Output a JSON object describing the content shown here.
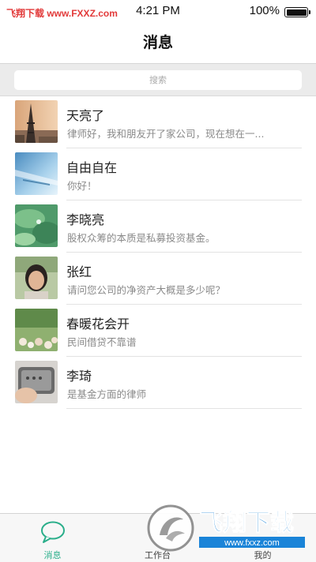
{
  "status_bar": {
    "watermark": "飞翔下载 www.FXXZ.com",
    "time": "4:21 PM",
    "battery_text": "100%",
    "battery_level": 1.0
  },
  "nav": {
    "title": "消息"
  },
  "search": {
    "placeholder": "搜索"
  },
  "chats": [
    {
      "name": "天亮了",
      "preview": "律师好，我和朋友开了家公司，现在想在一...",
      "avatar": "tower-avatar"
    },
    {
      "name": "自由自在",
      "preview": "你好！",
      "avatar": "blue-abstract-avatar"
    },
    {
      "name": "李晓亮",
      "preview": "股权众筹的本质是私募投资基金。",
      "avatar": "lotus-leaf-avatar"
    },
    {
      "name": "张红",
      "preview": "请问您公司的净资产大概是多少呢？",
      "avatar": "person-portrait-avatar"
    },
    {
      "name": "春暖花会开",
      "preview": "民间借贷不靠谱",
      "avatar": "flowers-avatar"
    },
    {
      "name": "李琦",
      "preview": "是基金方面的律师",
      "avatar": "hand-phone-avatar"
    }
  ],
  "tabs": [
    {
      "label": "消息",
      "icon": "chat-bubble-icon",
      "active": true
    },
    {
      "label": "工作台",
      "icon": "workspace-icon",
      "active": false
    },
    {
      "label": "我的",
      "icon": "profile-icon",
      "active": false
    }
  ],
  "watermark_logo": {
    "text": "飞翔下载",
    "url": "www.fxxz.com"
  },
  "colors": {
    "accent": "#2aae8a",
    "watermark_blue": "#1a84d8",
    "watermark_red": "#e23a3a"
  }
}
